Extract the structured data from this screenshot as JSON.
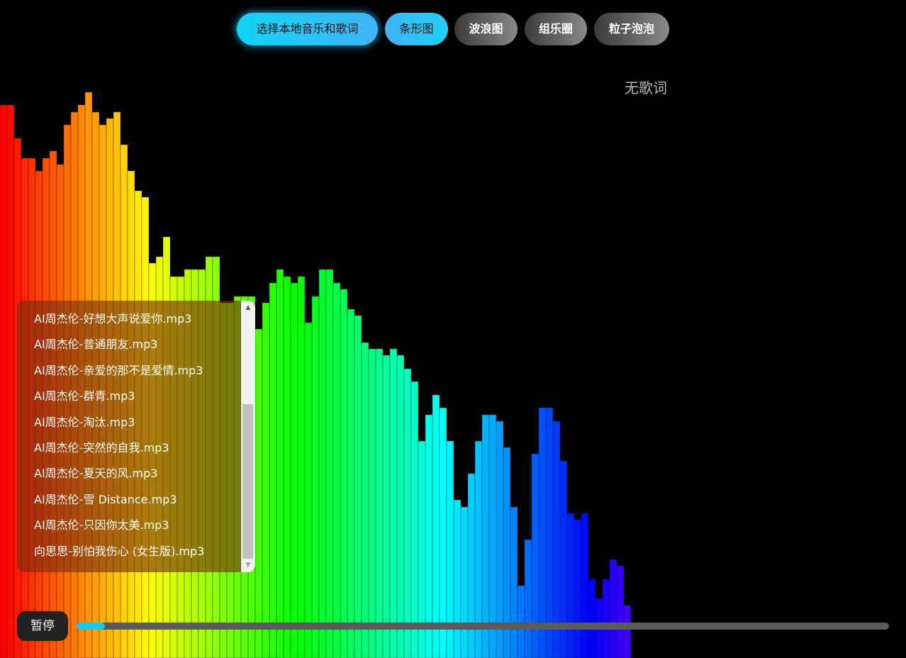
{
  "toolbar": {
    "choose_file_label": "选择本地音乐和歌词",
    "bar_chart_label": "条形图",
    "wave_label": "波浪图",
    "band_circle_label": "组乐圈",
    "particle_bubble_label": "粒子泡泡"
  },
  "lyric": {
    "text": "无歌词"
  },
  "playlist": {
    "items": [
      "AI周杰伦-好想大声说爱你.mp3",
      "AI周杰伦-普通朋友.mp3",
      "AI周杰伦-亲爱的那不是爱情.mp3",
      "AI周杰伦-群青.mp3",
      "AI周杰伦-淘汰.mp3",
      "AI周杰伦-突然的自我.mp3",
      "AI周杰伦-夏天的风.mp3",
      "AI周杰伦-雪 Distance.mp3",
      "AI周杰伦-只因你太美.mp3",
      "向思思-别怕我伤心 (女生版).mp3"
    ]
  },
  "player": {
    "pause_label": "暂停",
    "progress_fraction": 0.035
  },
  "spectrum": {
    "levels": [
      0.84,
      0.84,
      0.79,
      0.76,
      0.76,
      0.74,
      0.76,
      0.77,
      0.75,
      0.81,
      0.83,
      0.84,
      0.86,
      0.83,
      0.81,
      0.82,
      0.83,
      0.78,
      0.74,
      0.71,
      0.7,
      0.6,
      0.61,
      0.64,
      0.58,
      0.58,
      0.59,
      0.59,
      0.59,
      0.61,
      0.61,
      0.54,
      0.54,
      0.55,
      0.55,
      0.55,
      0.5,
      0.54,
      0.57,
      0.59,
      0.58,
      0.57,
      0.58,
      0.51,
      0.55,
      0.59,
      0.59,
      0.57,
      0.56,
      0.53,
      0.52,
      0.48,
      0.47,
      0.47,
      0.46,
      0.47,
      0.46,
      0.44,
      0.42,
      0.33,
      0.37,
      0.4,
      0.38,
      0.33,
      0.24,
      0.23,
      0.28,
      0.33,
      0.37,
      0.37,
      0.36,
      0.32,
      0.23,
      0.11,
      0.18,
      0.31,
      0.38,
      0.38,
      0.36,
      0.3,
      0.22,
      0.21,
      0.22,
      0.12,
      0.09,
      0.12,
      0.15,
      0.14,
      0.08
    ]
  },
  "colors": {
    "accent": "#17c8ef",
    "track": "#5a5a5a"
  }
}
